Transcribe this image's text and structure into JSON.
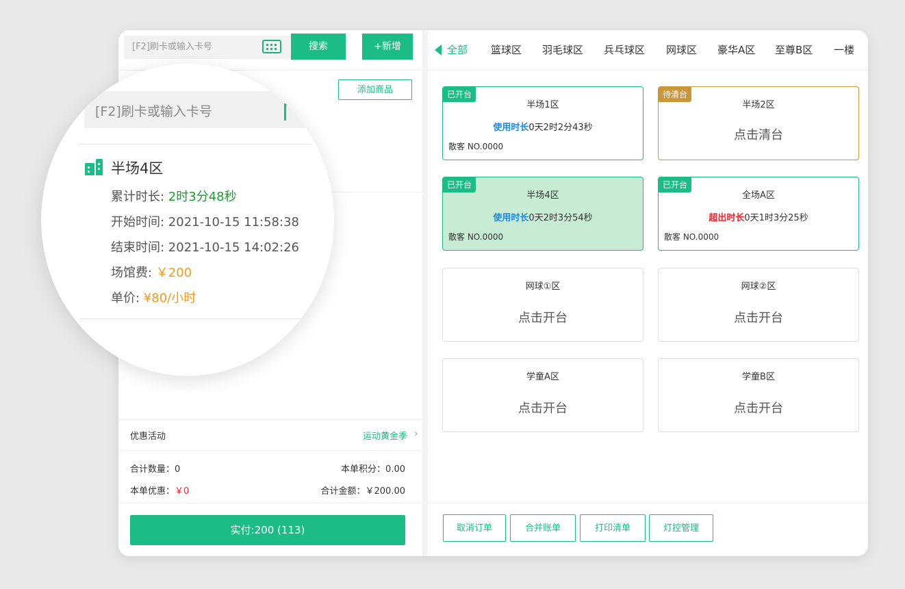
{
  "search": {
    "placeholder": "[F2]刷卡或输入卡号",
    "search_label": "搜索",
    "add_label": "+新增"
  },
  "add_product_label": "添加商品",
  "promo": {
    "label": "优惠活动",
    "value": "运动黄金季"
  },
  "summary": {
    "qty_label": "合计数量：0",
    "points_label": "本单积分：0.00",
    "discount_label": "本单优惠：",
    "discount_value": "￥0",
    "total_label": "合计金额：￥200.00"
  },
  "pay_label": "实付:200 (113)",
  "tabs": [
    "全部",
    "篮球区",
    "羽毛球区",
    "兵乓球区",
    "网球区",
    "豪华A区",
    "至尊B区",
    "一楼"
  ],
  "cards": [
    {
      "badge": "已开台",
      "name": "半场1区",
      "dur_label": "使用时长",
      "dur_value": "0天2时2分43秒",
      "customer": "散客 NO.0000"
    },
    {
      "badge": "待清台",
      "name": "半场2区",
      "action": "点击清台"
    },
    {
      "badge": "已开台",
      "name": "半场4区",
      "dur_label": "使用时长",
      "dur_value": "0天2时3分54秒",
      "customer": "散客 NO.0000"
    },
    {
      "badge": "已开台",
      "name": "全场A区",
      "dur_label": "超出时长",
      "dur_value": "0天1时3分25秒",
      "customer": "散客 NO.0000"
    },
    {
      "name": "网球①区",
      "action": "点击开台"
    },
    {
      "name": "网球②区",
      "action": "点击开台"
    },
    {
      "name": "学童A区",
      "action": "点击开台"
    },
    {
      "name": "学童B区",
      "action": "点击开台"
    }
  ],
  "bottom_buttons": [
    "取消订单",
    "合并账单",
    "打印清单",
    "灯控管理"
  ],
  "magnifier": {
    "input_placeholder": "[F2]刷卡或输入卡号",
    "title": "半场4区",
    "rows": [
      {
        "label": "累计时长: ",
        "value": "2时3分48秒"
      },
      {
        "label": "开始时间: ",
        "value": "2021-10-15 11:58:38"
      },
      {
        "label": "结束时间: ",
        "value": "2021-10-15 14:02:26"
      },
      {
        "label": "场馆费: ",
        "value": "￥200"
      },
      {
        "label": "单价: ",
        "value": "¥80/小时"
      }
    ]
  },
  "colors": {
    "accent": "#1bbc86",
    "pending": "#c9963a",
    "danger": "#f5222d",
    "info": "#1e88e5",
    "price": "#f39a1a"
  }
}
